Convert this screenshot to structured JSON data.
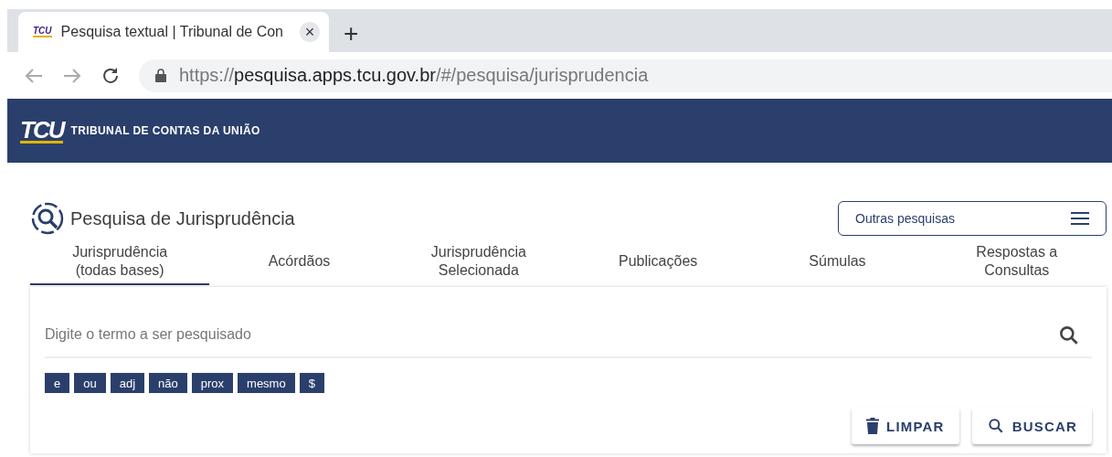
{
  "browser": {
    "tab": {
      "favicon_text": "TCU",
      "title": "Pesquisa textual | Tribunal de Con",
      "close": "×"
    },
    "new_tab": "+",
    "url": {
      "scheme": "https://",
      "host": "pesquisa.apps.tcu.gov.br",
      "path": "/#/pesquisa/jurisprudencia"
    }
  },
  "header": {
    "logo": "TCU",
    "name": "TRIBUNAL DE CONTAS DA UNIÃO"
  },
  "page_title": "Pesquisa de Jurisprudência",
  "other_searches": {
    "label": "Outras pesquisas"
  },
  "tabs": [
    {
      "label": "Jurisprudência\n(todas bases)",
      "selected": true
    },
    {
      "label": "Acórdãos",
      "selected": false
    },
    {
      "label": "Jurisprudência\nSelecionada",
      "selected": false
    },
    {
      "label": "Publicações",
      "selected": false
    },
    {
      "label": "Súmulas",
      "selected": false
    },
    {
      "label": "Respostas a\nConsultas",
      "selected": false
    }
  ],
  "search": {
    "placeholder": "Digite o termo a ser pesquisado"
  },
  "operators": [
    "e",
    "ou",
    "adj",
    "não",
    "prox",
    "mesmo",
    "$"
  ],
  "buttons": [
    {
      "kind": "clear",
      "label": "LIMPAR"
    },
    {
      "kind": "search",
      "label": "BUSCAR"
    }
  ]
}
